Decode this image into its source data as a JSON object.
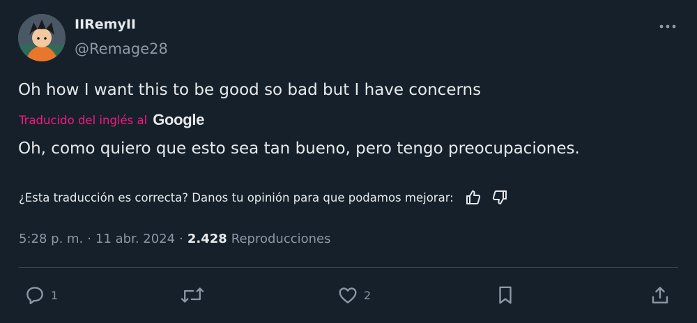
{
  "author": {
    "display_name": "IIRemyII",
    "handle": "@Remage28",
    "avatar_icon": "avatar-character"
  },
  "tweet": {
    "text": "Oh how I want this to be good so bad but I have concerns",
    "translation_label": "Traducido del inglés al",
    "translation_provider": "Google",
    "translated_text": "Oh, como quiero que esto sea tan bueno, pero tengo preocupaciones.",
    "feedback_prompt": "¿Esta traducción es correcta? Danos tu opinión para que podamos mejorar:"
  },
  "meta": {
    "time": "5:28 p. m.",
    "separator": "·",
    "date": "11 abr. 2024",
    "views_count": "2.428",
    "views_label": "Reproducciones"
  },
  "actions": {
    "reply_count": "1",
    "like_count": "2"
  },
  "colors": {
    "background": "#15202b",
    "text": "#e7e9ea",
    "secondary": "#8b98a5",
    "accent_pink": "#f91880",
    "divider": "#38444d"
  }
}
